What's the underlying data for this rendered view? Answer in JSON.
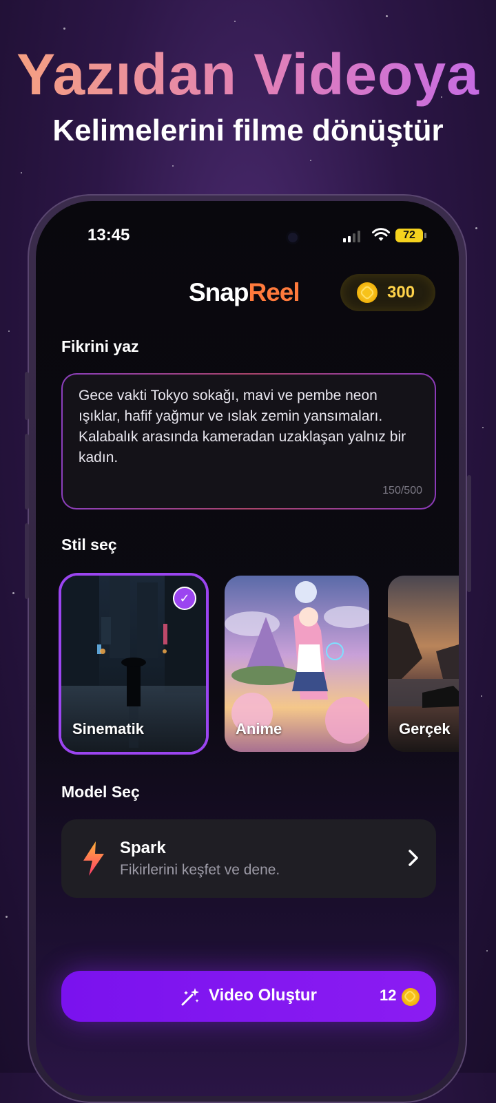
{
  "hero": {
    "title": "Yazıdan Videoya",
    "subtitle": "Kelimelerini filme dönüştür"
  },
  "status_bar": {
    "time": "13:45",
    "battery": "72"
  },
  "header": {
    "logo_part1": "Snap",
    "logo_part2": "Reel",
    "coins": "300"
  },
  "prompt": {
    "label": "Fikrini yaz",
    "text": "Gece vakti Tokyo sokağı, mavi ve pembe neon ışıklar, hafif yağmur ve ıslak zemin yansımaları. Kalabalık arasında kameradan uzaklaşan yalnız bir kadın.",
    "char_count": "150/500"
  },
  "styles": {
    "label": "Stil seç",
    "items": [
      {
        "label": "Sinematik",
        "selected": true
      },
      {
        "label": "Anime",
        "selected": false
      },
      {
        "label": "Gerçek",
        "selected": false
      }
    ],
    "check": "✓"
  },
  "model": {
    "label": "Model Seç",
    "name": "Spark",
    "description": "Fikirlerini keşfet ve dene."
  },
  "cta": {
    "label": "Video Oluştur",
    "cost": "12"
  },
  "colors": {
    "accent": "#9b45f0",
    "cta": "#8b1cf2",
    "coin": "#ffd34a",
    "logo_accent": "#ff7a3c"
  }
}
